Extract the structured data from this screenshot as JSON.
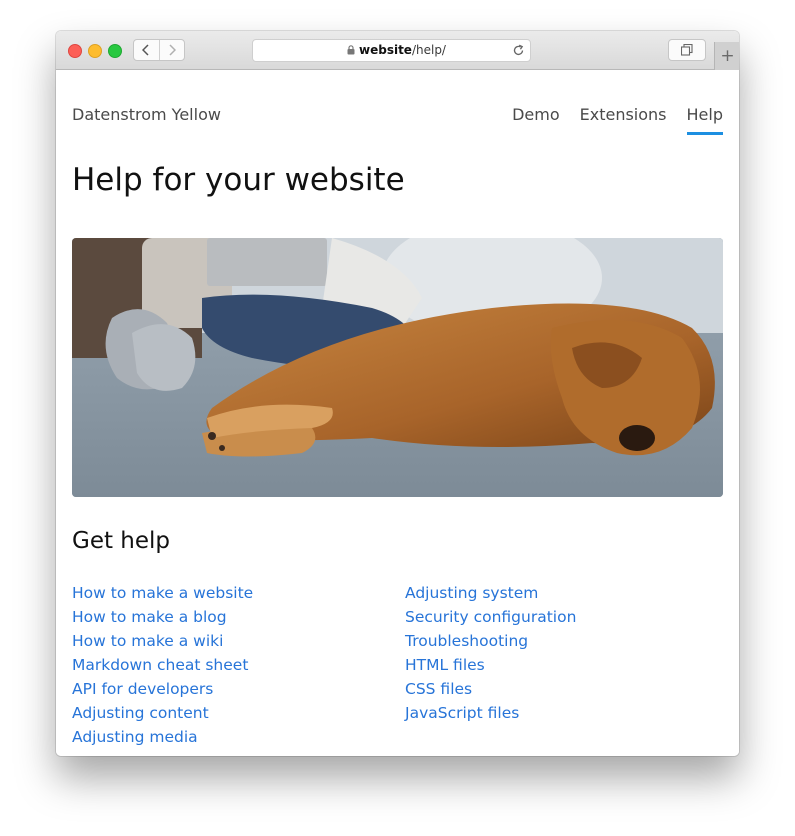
{
  "browser": {
    "url_domain": "website",
    "url_path": "/help/"
  },
  "site": {
    "name": "Datenstrom Yellow",
    "menu": [
      {
        "label": "Demo",
        "active": false
      },
      {
        "label": "Extensions",
        "active": false
      },
      {
        "label": "Help",
        "active": true
      }
    ]
  },
  "page": {
    "title": "Help for your website",
    "hero_image_alt": "Dog sleeping on a rug next to a person with a laptop",
    "section_title": "Get help",
    "links_col1": [
      "How to make a website",
      "How to make a blog",
      "How to make a wiki",
      "Markdown cheat sheet",
      "API for developers",
      "Adjusting content",
      "Adjusting media"
    ],
    "links_col2": [
      "Adjusting system",
      "Security configuration",
      "Troubleshooting",
      "HTML files",
      "CSS files",
      "JavaScript files"
    ]
  },
  "colors": {
    "link": "#2774d8",
    "active_underline": "#1d8fe1",
    "close": "#fc5f57",
    "minimize": "#fdbc2e",
    "zoom": "#28c840"
  },
  "icons": [
    "back-icon",
    "forward-icon",
    "lock-icon",
    "reload-icon",
    "tabs-icon",
    "plus-icon"
  ]
}
